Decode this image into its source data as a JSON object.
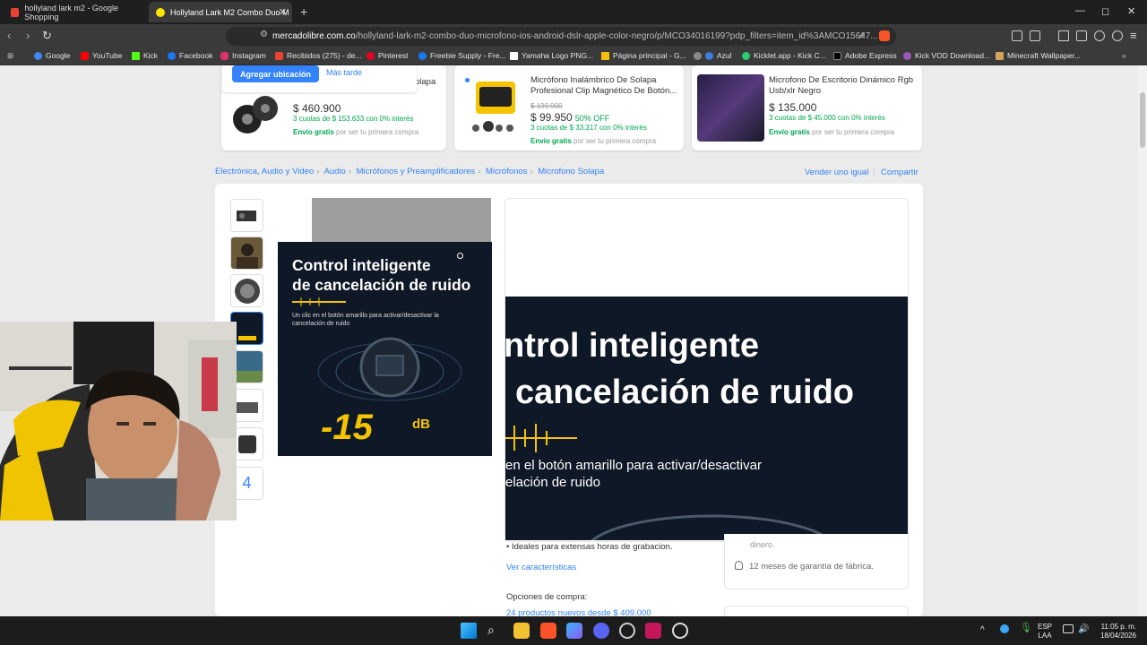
{
  "tabs": [
    {
      "title": "hollyland lark m2 - Google Shopping",
      "favicon_color": "#ea4335"
    },
    {
      "title": "Hollyland Lark M2 Combo Duo M",
      "favicon_color": "#ffe600"
    }
  ],
  "window_controls": {
    "minimize": "—",
    "maximize": "◻",
    "close": "✕"
  },
  "url": {
    "host": "mercadolibre.com.co",
    "path": "/hollyland-lark-m2-combo-duo-microfono-ios-android-dslr-apple-color-negro/p/MCO34016199?pdp_filters=item_id%3AMCO15647..."
  },
  "bookmarks": [
    {
      "label": "Google",
      "color": "#4285f4"
    },
    {
      "label": "YouTube",
      "color": "#ff0000"
    },
    {
      "label": "Kick",
      "color": "#53fc18"
    },
    {
      "label": "Facebook",
      "color": "#1877f2"
    },
    {
      "label": "Instagram",
      "color": "#e1306c"
    },
    {
      "label": "Recibidos (275) - de...",
      "color": "#ea4335"
    },
    {
      "label": "Pinterest",
      "color": "#e60023"
    },
    {
      "label": "Freebie Supply - Fre...",
      "color": "#1877f2"
    },
    {
      "label": "Yamaha Logo PNG...",
      "color": "#ffffff"
    },
    {
      "label": "Página principal - G...",
      "color": "#fbbc05"
    },
    {
      "label": "Azul",
      "color": "#888888"
    },
    {
      "label": "Kicklet.app - Kick C...",
      "color": "#2ecc71"
    },
    {
      "label": "Adobe Express",
      "color": "#000000"
    },
    {
      "label": "Kick VOD Download...",
      "color": "#9b59b6"
    },
    {
      "label": "Minecraft Wallpaper...",
      "color": "#d4a25a"
    }
  ],
  "location_popup": {
    "primary": "Agregar ubicación",
    "secondary": "Más tarde"
  },
  "related": [
    {
      "title": "olapa",
      "price": "$ 460.900",
      "installments": "3 cuotas de $ 153.633 con 0% interés",
      "shipping_bold": "Envío gratis",
      "shipping": "por ser tu primera compra"
    },
    {
      "title": "Micrófono Inalámbrico De Solapa Profesional Clip Magnético De Botón...",
      "old_price": "$ 199.900",
      "price": "$ 99.950",
      "discount": "50% OFF",
      "installments": "3 cuotas de $ 33.317 con 0% interés",
      "shipping_bold": "Envío gratis",
      "shipping": "por ser tu primera compra"
    },
    {
      "title": "Microfono De Escritorio Dinámico Rgb Usb/xlr Negro",
      "price": "$ 135.000",
      "installments": "3 cuotas de $ 45.000 con 0% interés",
      "shipping_bold": "Envío gratis",
      "shipping": "por ser tu primera compra"
    }
  ],
  "breadcrumb": [
    "Electrónica, Audio y Video",
    "Audio",
    "Micrófonos y Preamplificadores",
    "Micrófonos",
    "Microfono Solapa"
  ],
  "seller_links": {
    "sell": "Vender uno igual",
    "share": "Compartir"
  },
  "gallery": {
    "more_count": "4",
    "image_title_1": "Control inteligente",
    "image_title_2": "de cancelación de ruido",
    "image_sub": "Un clic en el botón amarillo para activar/desactivar la cancelación de ruido",
    "image_db": "-15",
    "image_db_unit": "dB"
  },
  "zoom": {
    "title_1": "ntrol inteligente",
    "title_2": "cancelación de ruido",
    "sub_1": "en el botón amarillo para activar/desactivar",
    "sub_2": "elación de ruido"
  },
  "product": {
    "bullet": "Ideales para extensas horas de grabacion.",
    "see_features": "Ver características",
    "purchase_options": "Opciones de compra:",
    "new_products": "24 productos nuevos desde $ 409.000"
  },
  "side": {
    "money": "dinero.",
    "warranty": "12 meses de garantía de fábrica."
  },
  "tray": {
    "lang1": "ESP",
    "lang2": "LAA",
    "time": "11:05 p. m.",
    "date": "18/04/2026"
  },
  "colors": {
    "ml_blue": "#3483fa",
    "ml_green": "#00a650",
    "ml_yellow": "#ffe600"
  }
}
